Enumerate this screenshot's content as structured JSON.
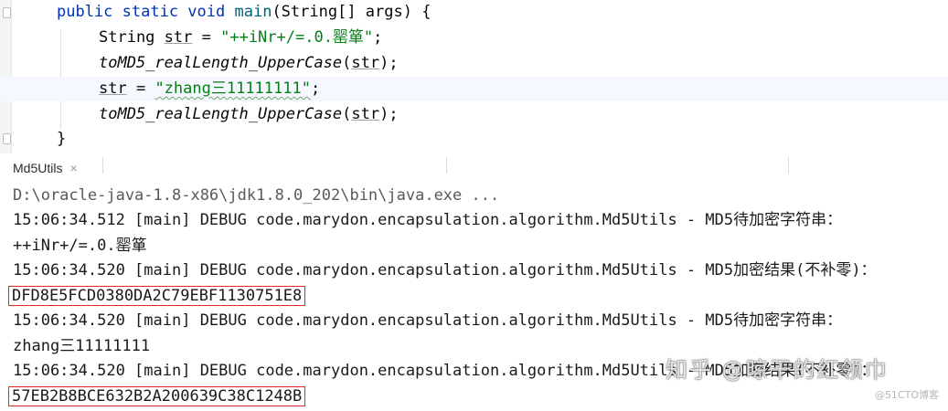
{
  "editor": {
    "lines": [
      {
        "kw1": "public static void",
        "fn": "main",
        "rest": "(String[] args) {"
      },
      {
        "type": "String",
        "var": "str",
        "eq": " = ",
        "str": "\"++iNr+/=.0.罂箪\"",
        "end": ";"
      },
      {
        "call": "toMD5_realLength_UpperCase",
        "open": "(",
        "arg": "str",
        "close": ");"
      },
      {
        "var": "str",
        "eq": " = ",
        "str": "\"zhang三11111111\"",
        "end": ";"
      },
      {
        "call": "toMD5_realLength_UpperCase",
        "open": "(",
        "arg": "str",
        "close": ");"
      },
      {
        "brace": "}"
      }
    ]
  },
  "tab": {
    "label": "Md5Utils",
    "close": "×"
  },
  "console": {
    "lines": [
      "D:\\oracle-java-1.8-x86\\jdk1.8.0_202\\bin\\java.exe ...",
      "15:06:34.512 [main] DEBUG code.marydon.encapsulation.algorithm.Md5Utils - MD5待加密字符串：",
      "++iNr+/=.0.罂箪",
      "15:06:34.520 [main] DEBUG code.marydon.encapsulation.algorithm.Md5Utils - MD5加密结果(不补零)：",
      "DFD8E5FCD0380DA2C79EBF1130751E8",
      "15:06:34.520 [main] DEBUG code.marydon.encapsulation.algorithm.Md5Utils - MD5待加密字符串：",
      "zhang三11111111",
      "15:06:34.520 [main] DEBUG code.marydon.encapsulation.algorithm.Md5Utils - MD5加密结果(不补零)：",
      "57EB2B8BCE632B2A200639C38C1248B"
    ]
  },
  "watermark": {
    "main": "知乎 @晾干的红领巾",
    "small": "@51CTO博客"
  },
  "colors": {
    "keyword": "#0033b3",
    "method": "#00627a",
    "string": "#067d17",
    "highlight_box": "#e02a2a"
  }
}
